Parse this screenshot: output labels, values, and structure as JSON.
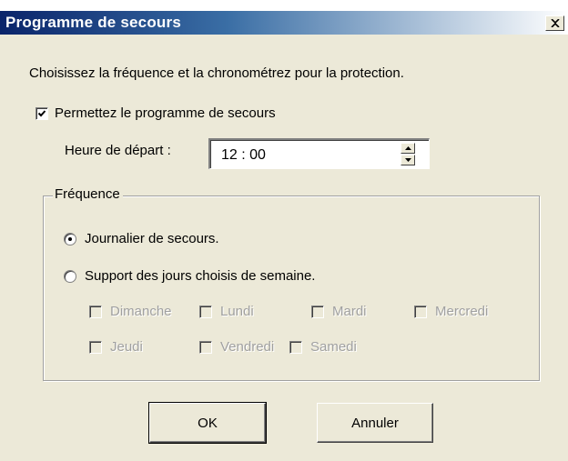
{
  "window": {
    "title": "Programme de secours"
  },
  "instruction": "Choisissez la fréquence et la chronométrez pour la protection.",
  "enable_schedule": {
    "label": "Permettez le programme de secours",
    "checked": true
  },
  "start_time": {
    "label": "Heure de départ :",
    "value": "12 : 00"
  },
  "frequency": {
    "legend": "Fréquence",
    "daily": {
      "label": "Journalier de secours.",
      "selected": true
    },
    "weekly": {
      "label": "Support des jours choisis de semaine.",
      "selected": false
    },
    "days": [
      {
        "label": "Dimanche",
        "checked": false,
        "enabled": false
      },
      {
        "label": "Lundi",
        "checked": false,
        "enabled": false
      },
      {
        "label": "Mardi",
        "checked": false,
        "enabled": false
      },
      {
        "label": "Mercredi",
        "checked": false,
        "enabled": false
      },
      {
        "label": "Jeudi",
        "checked": false,
        "enabled": false
      },
      {
        "label": "Vendredi",
        "checked": false,
        "enabled": false
      },
      {
        "label": "Samedi",
        "checked": false,
        "enabled": false
      }
    ]
  },
  "buttons": {
    "ok": "OK",
    "cancel": "Annuler"
  },
  "colors": {
    "dialog_background": "#ece9d8",
    "titlebar_start": "#0a246a",
    "titlebar_end": "#ffffff",
    "disabled_text": "#a0a0a0"
  }
}
